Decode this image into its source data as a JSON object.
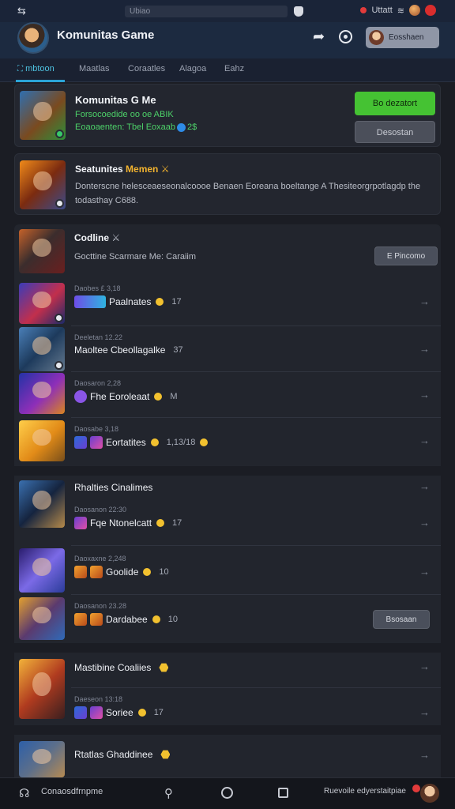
{
  "status": {
    "url": "Ubiao",
    "right_text": "Uttatt"
  },
  "header": {
    "title": "Komunitas Game",
    "profile_label": "Eosshaen"
  },
  "tabs": [
    {
      "label": "mbtoon",
      "active": true
    },
    {
      "label": "Maatlas",
      "active": false
    },
    {
      "label": "Coraatles",
      "active": false
    },
    {
      "label": "Alagoa",
      "active": false
    },
    {
      "label": "Eahz",
      "active": false
    }
  ],
  "featured": {
    "title": "Komunitas G Me",
    "line1": "Forsocoedide oo oe ABIK",
    "line2": "Eoaoaenten: Tbel Eoxaab",
    "primary_btn": "Bo dezatort",
    "secondary_btn": "Desostan"
  },
  "announce": {
    "title": "Seatunites",
    "title_highlight": "Memen",
    "text": "Donterscne helesceaeseonalcoooe Benaen Eoreana boeltange A Thesiteorgrpotlagdp the todasthay C688."
  },
  "online": {
    "title": "Codline",
    "subtitle": "Gocttine Scarmare Me: Caraiim",
    "button": "E Pincomo"
  },
  "rows": [
    {
      "meta": "Daobes £ 3,18",
      "title": "Paalnates",
      "count": "17"
    },
    {
      "meta": "Deeletan 12.22",
      "title": "Maoltee Cbeollagalke",
      "count": "37"
    },
    {
      "meta": "Daosaron 2,28",
      "title": "Fhe Eoroleaat",
      "count": "M"
    },
    {
      "meta": "Daosabe 3,18",
      "title": "Eortatites",
      "count": "1,13/18"
    },
    {
      "meta": "",
      "title": "Rhalties Cinalimes",
      "count": ""
    },
    {
      "meta": "Daosanon 22:30",
      "title": "Fqe Ntonelcatt",
      "count": "17"
    },
    {
      "meta": "Daoxaxne 2,248",
      "title": "Goolide",
      "count": "10"
    },
    {
      "meta": "Daosanon 23.28",
      "title": "Dardabee",
      "count": "10",
      "button": "Bsosaan"
    },
    {
      "meta": "",
      "title": "Mastibine Coaliies",
      "count": ""
    },
    {
      "meta": "Daeseon 13:18",
      "title": "Soriee",
      "count": "17"
    },
    {
      "meta": "",
      "title": "Rtatlas Ghaddinee",
      "count": ""
    }
  ],
  "bottom": {
    "left_label": "Conaosdfrnpme",
    "right_label": "Ruevoile edyerstaitpiae"
  }
}
